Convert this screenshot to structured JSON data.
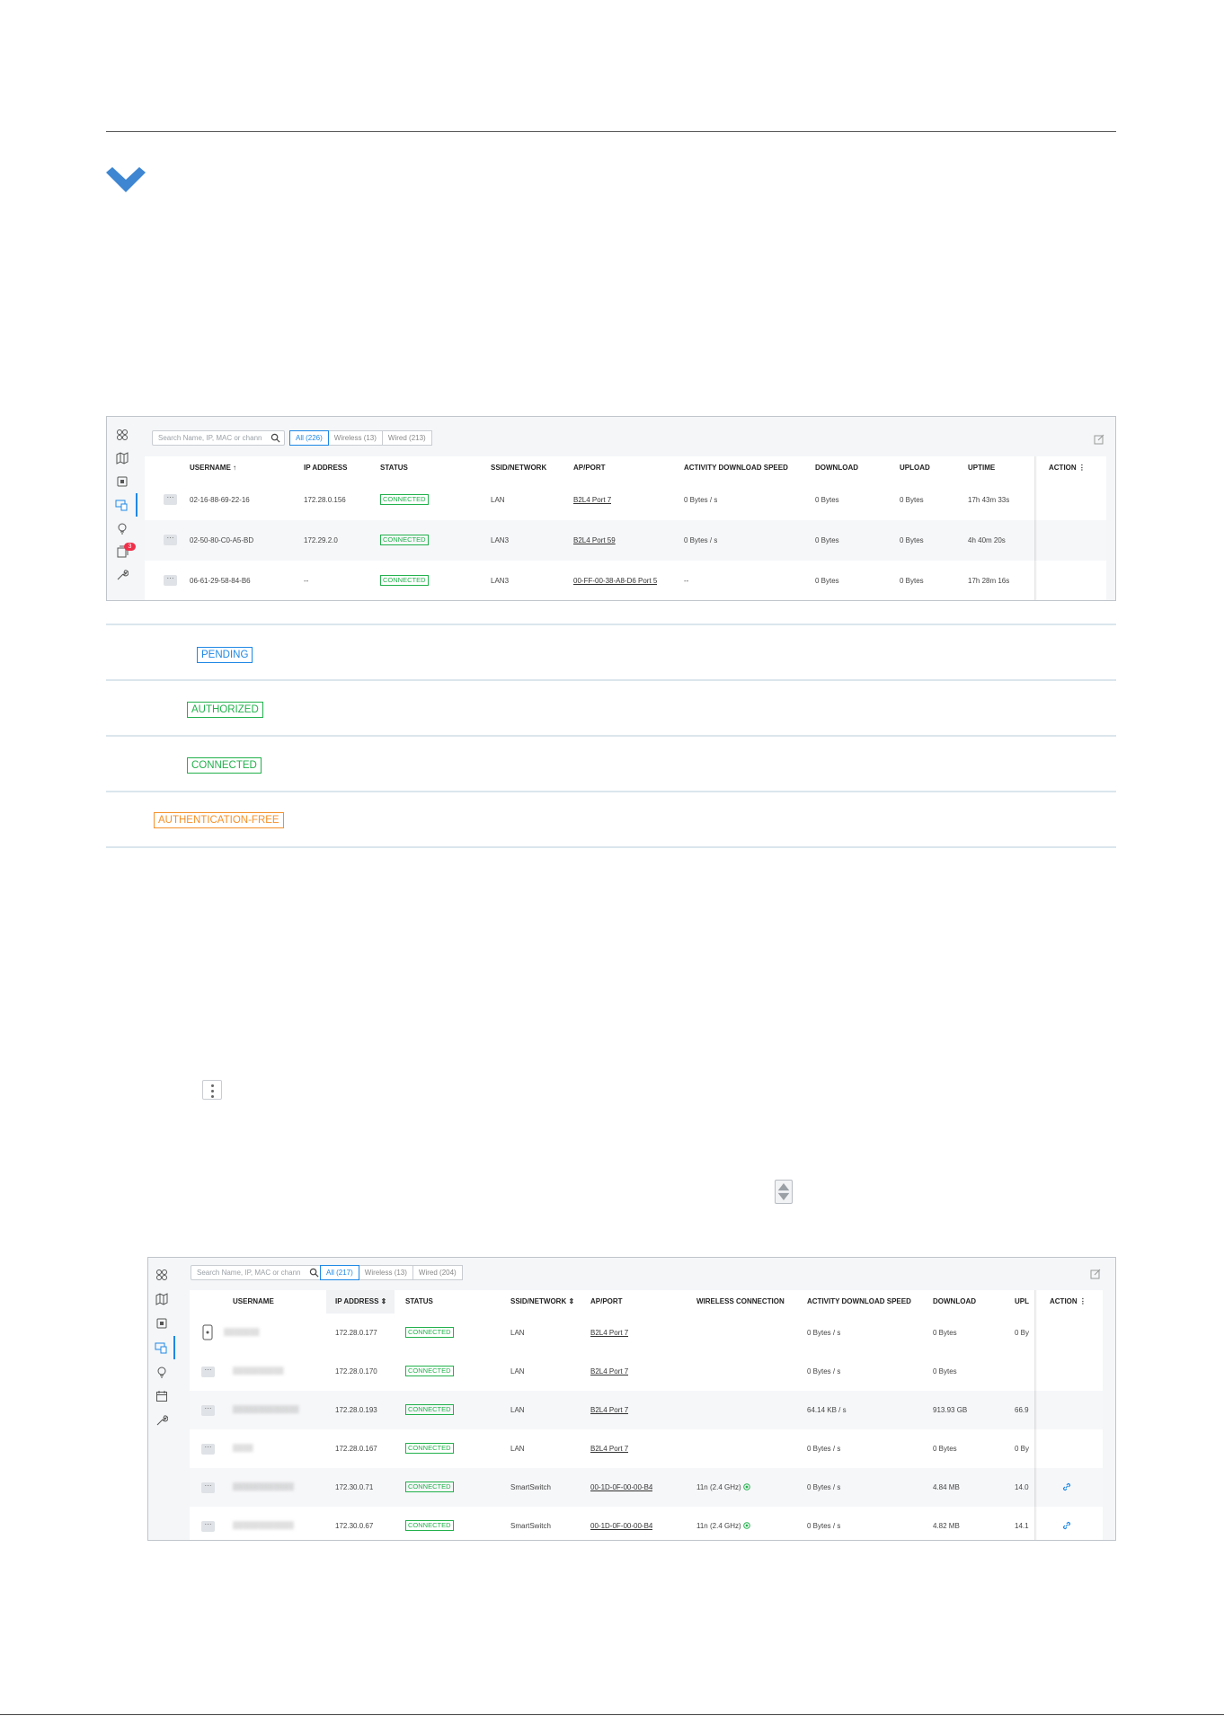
{
  "shot1": {
    "search_placeholder": "Search Name, IP, MAC or chann",
    "tabs": [
      "All (226)",
      "Wireless (13)",
      "Wired (213)"
    ],
    "sidebar_badge": "3",
    "headers": {
      "username": "USERNAME ↑",
      "ip": "IP ADDRESS",
      "status": "STATUS",
      "ssid": "SSID/NETWORK",
      "ap": "AP/PORT",
      "activity": "ACTIVITY DOWNLOAD SPEED",
      "download": "DOWNLOAD",
      "upload": "UPLOAD",
      "uptime": "UPTIME",
      "action": "ACTION ⋮"
    },
    "rows": [
      {
        "username": "02-16-88-69-22-16",
        "ip": "172.28.0.156",
        "status": "CONNECTED",
        "ssid": "LAN",
        "ap": "B2L4 Port 7",
        "activity": "0 Bytes / s",
        "download": "0 Bytes",
        "upload": "0 Bytes",
        "uptime": "17h 43m 33s"
      },
      {
        "username": "02-50-80-C0-A5-BD",
        "ip": "172.29.2.0",
        "status": "CONNECTED",
        "ssid": "LAN3",
        "ap": "B2L4 Port 59",
        "activity": "0 Bytes / s",
        "download": "0 Bytes",
        "upload": "0 Bytes",
        "uptime": "4h 40m 20s"
      },
      {
        "username": "06-61-29-58-84-B6",
        "ip": "--",
        "status": "CONNECTED",
        "ssid": "LAN3",
        "ap": "00-FF-00-38-A8-D6 Port 5",
        "activity": "--",
        "download": "0 Bytes",
        "upload": "0 Bytes",
        "uptime": "17h 28m 16s"
      }
    ],
    "more_label": "···"
  },
  "legend": {
    "pending": "PENDING",
    "authorized": "AUTHORIZED",
    "connected": "CONNECTED",
    "auth_free": "AUTHENTICATION-FREE"
  },
  "shot2": {
    "search_placeholder": "Search Name, IP, MAC or chann",
    "tabs": [
      "All (217)",
      "Wireless (13)",
      "Wired (204)"
    ],
    "headers": {
      "username": "USERNAME",
      "ip": "IP ADDRESS ⇕",
      "status": "STATUS",
      "ssid": "SSID/NETWORK ⇕",
      "ap": "AP/PORT",
      "wireless": "WIRELESS CONNECTION",
      "activity": "ACTIVITY DOWNLOAD SPEED",
      "download": "DOWNLOAD",
      "upload": "UPL",
      "action": "ACTION ⋮"
    },
    "rows": [
      {
        "username": "",
        "ip": "172.28.0.177",
        "status": "CONNECTED",
        "ssid": "LAN",
        "ap": "B2L4 Port 7",
        "wireless": "",
        "activity": "0 Bytes / s",
        "download": "0 Bytes",
        "upload": "0 By"
      },
      {
        "username": "",
        "ip": "172.28.0.170",
        "status": "CONNECTED",
        "ssid": "LAN",
        "ap": "B2L4 Port 7",
        "wireless": "",
        "activity": "0 Bytes / s",
        "download": "0 Bytes",
        "upload": ""
      },
      {
        "username": "",
        "ip": "172.28.0.193",
        "status": "CONNECTED",
        "ssid": "LAN",
        "ap": "B2L4 Port 7",
        "wireless": "",
        "activity": "64.14 KB / s",
        "download": "913.93 GB",
        "upload": "66.9"
      },
      {
        "username": "",
        "ip": "172.28.0.167",
        "status": "CONNECTED",
        "ssid": "LAN",
        "ap": "B2L4 Port 7",
        "wireless": "",
        "activity": "0 Bytes / s",
        "download": "0 Bytes",
        "upload": "0 By"
      },
      {
        "username": "",
        "ip": "172.30.0.71",
        "status": "CONNECTED",
        "ssid": "SmartSwitch",
        "ap": "00-1D-0F-00-00-B4",
        "wireless": "11n (2.4 GHz)",
        "activity": "0 Bytes / s",
        "download": "4.84 MB",
        "upload": "14.0"
      },
      {
        "username": "",
        "ip": "172.30.0.67",
        "status": "CONNECTED",
        "ssid": "SmartSwitch",
        "ap": "00-1D-0F-00-00-B4",
        "wireless": "11n (2.4 GHz)",
        "activity": "0 Bytes / s",
        "download": "4.82 MB",
        "upload": "14.1"
      }
    ],
    "more_label": "···"
  },
  "colors": {
    "accent": "#1e88e5",
    "connected": "#22b14c",
    "auth_free": "#f5912a",
    "badge": "#f0304a"
  }
}
